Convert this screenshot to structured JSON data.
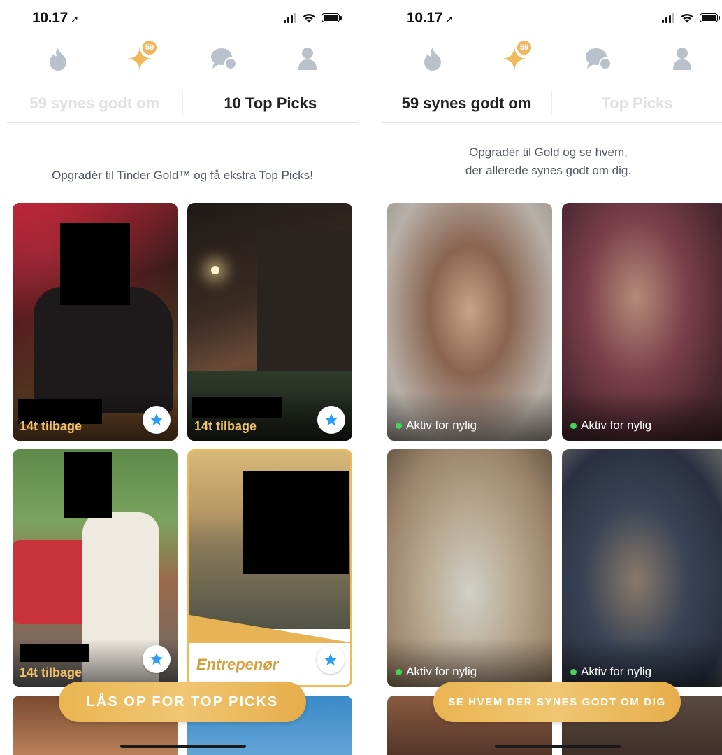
{
  "left": {
    "status_time": "10.17",
    "tabs": {
      "likes": "59 synes godt om",
      "top_picks": "10 Top Picks"
    },
    "badge_count": "59",
    "promo": "Opgradér til Tinder Gold™ og få ekstra Top Picks!",
    "cards": [
      {
        "label": "14t tilbage"
      },
      {
        "label": "14t tilbage"
      },
      {
        "label": "14t tilbage"
      },
      {
        "label": "Entrepenør"
      }
    ],
    "cta": "LÅS OP FOR TOP PICKS"
  },
  "right": {
    "status_time": "10.17",
    "tabs": {
      "likes": "59 synes godt om",
      "top_picks": "Top Picks"
    },
    "badge_count": "59",
    "promo_line1": "Opgradér til Gold og se hvem,",
    "promo_line2": "der allerede synes godt om dig.",
    "cards": [
      {
        "label": "Aktiv for nylig"
      },
      {
        "label": "Aktiv for nylig"
      },
      {
        "label": "Aktiv for nylig"
      },
      {
        "label": "Aktiv for nylig"
      }
    ],
    "cta": "SE HVEM DER SYNES GODT OM DIG"
  },
  "colors": {
    "gold": "#f0b95a",
    "icon_gray": "#b9c1cb",
    "tab_active": "#222222",
    "tab_inactive": "#e0e0e0",
    "online_dot": "#47d25b",
    "star_blue": "#2a9df4"
  }
}
